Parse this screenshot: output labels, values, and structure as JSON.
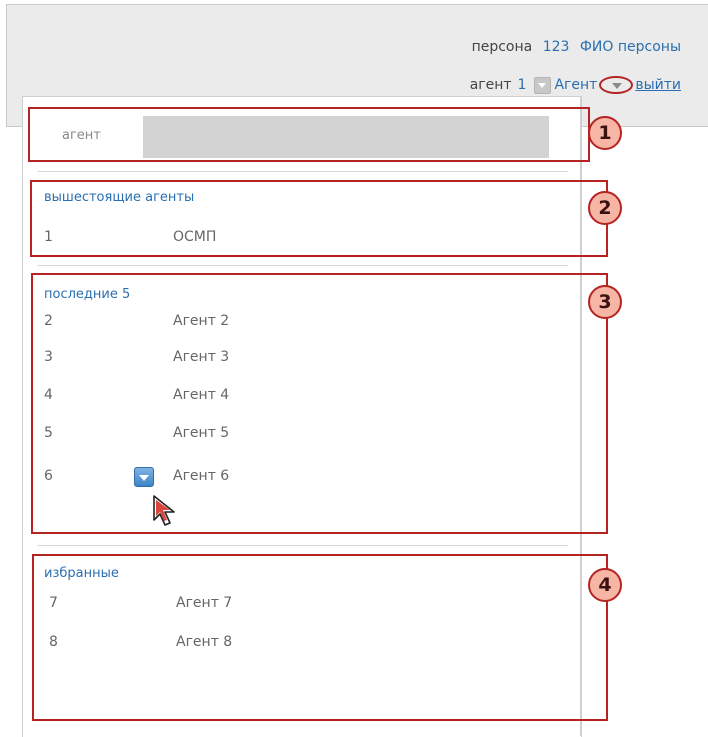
{
  "header": {
    "persona_label": "персона",
    "persona_id": "123",
    "persona_name": "ФИО персоны",
    "agent_label": "агент",
    "agent_id": "1",
    "agent_name": "Агент",
    "logout": "выйти"
  },
  "panel": {
    "search_label": "агент",
    "search_value": "",
    "superior": {
      "title": "вышестоящие агенты",
      "rows": [
        {
          "num": "1",
          "name": "ОСМП"
        }
      ]
    },
    "recent": {
      "title": "последние 5",
      "rows": [
        {
          "num": "2",
          "name": "Агент 2"
        },
        {
          "num": "3",
          "name": "Агент 3"
        },
        {
          "num": "4",
          "name": "Агент 4"
        },
        {
          "num": "5",
          "name": "Агент 5"
        },
        {
          "num": "6",
          "name": "Агент 6"
        }
      ]
    },
    "favorites": {
      "title": "избранные",
      "rows": [
        {
          "num": "7",
          "name": "Агент 7"
        },
        {
          "num": "8",
          "name": "Агент 8"
        }
      ]
    }
  },
  "callouts": [
    "1",
    "2",
    "3",
    "4"
  ],
  "icons": {
    "agent_dropdown": "chevron-down-icon",
    "row_dropdown": "chevron-down-icon",
    "pointer": "mouse-cursor-icon"
  },
  "colors": {
    "accent_blue": "#2a6fb1",
    "callout_border": "#b52323",
    "callout_fill": "#f6b5a5"
  }
}
